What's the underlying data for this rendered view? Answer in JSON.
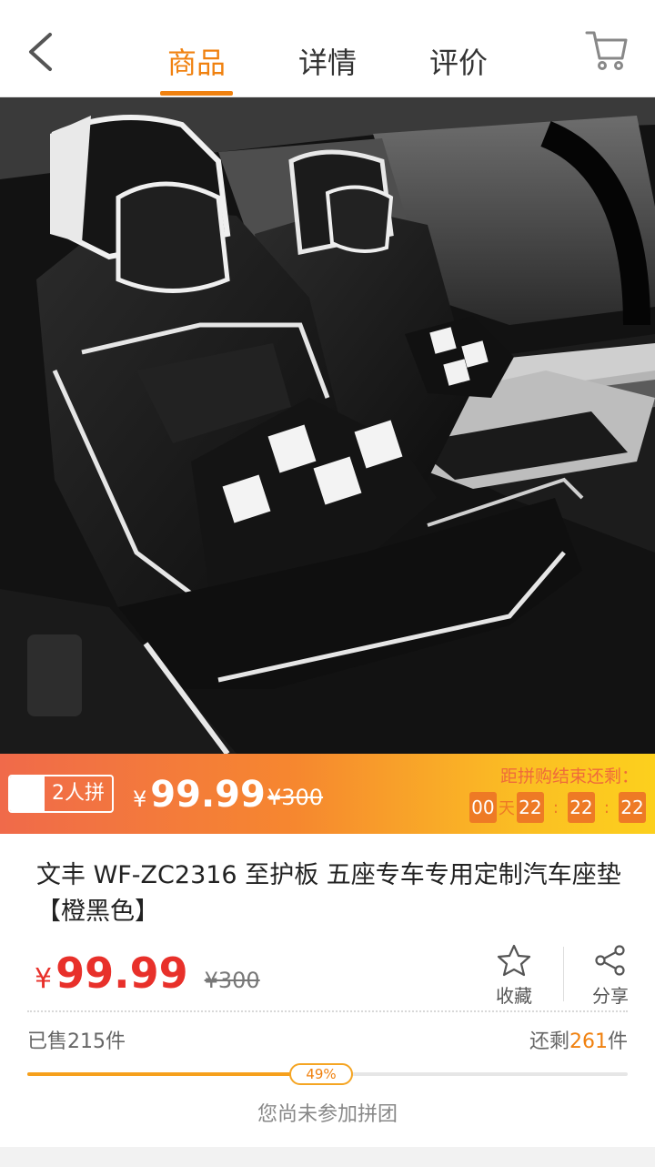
{
  "header": {
    "tabs": [
      {
        "label": "商品",
        "active": true
      },
      {
        "label": "详情",
        "active": false
      },
      {
        "label": "评价",
        "active": false
      }
    ],
    "accent_color": "#f0810f"
  },
  "hero": {
    "alt_icon": "car-seat-photo"
  },
  "group_buy": {
    "badge_label": "2人拼",
    "currency": "¥",
    "price": "99.99",
    "original_price": "¥300",
    "countdown_label": "距拼购结束还剩：",
    "days": "00",
    "days_unit": "天",
    "hours": "22",
    "minutes": "22",
    "seconds": "22",
    "sep": ":"
  },
  "product": {
    "title": "文丰 WF-ZC2316 至护板 五座专车专用定制汽车座垫【橙黑色】",
    "currency": "¥",
    "price": "99.99",
    "original_price": "¥300",
    "favorite_label": "收藏",
    "share_label": "分享",
    "sold_text": "已售215件",
    "remain_prefix": "还剩",
    "remain_count": "261",
    "remain_suffix": "件",
    "progress_label": "49%",
    "progress_value": 0.49,
    "join_note": "您尚未参加拼团"
  }
}
